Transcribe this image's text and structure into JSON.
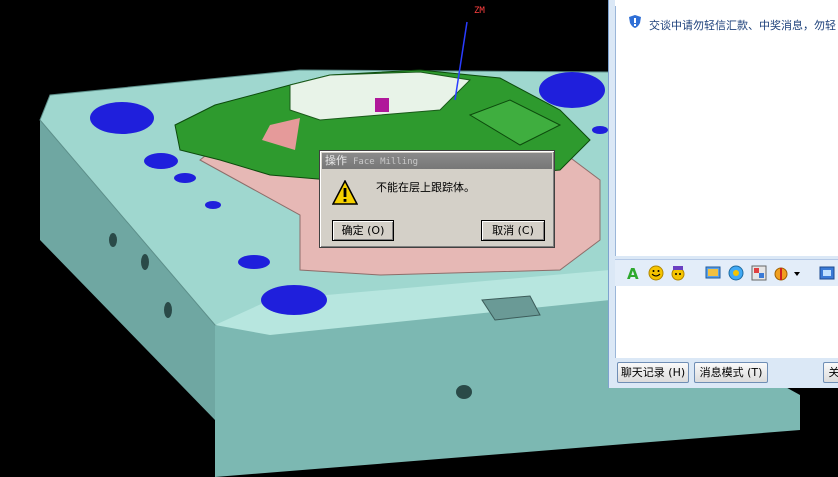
{
  "viewport": {
    "axis_label": "ZM"
  },
  "dialog": {
    "title": "操作",
    "app_name": "Face Milling",
    "message": "不能在层上跟踪体。",
    "ok_label": "确定 (O)",
    "cancel_label": "取消 (C)",
    "icon": "warning-icon"
  },
  "chat": {
    "notice": "交谈中请勿轻信汇款、中奖消息，勿轻",
    "toolbar_icons": [
      "font-icon",
      "emoticon-icon",
      "magic-emoticon-icon",
      "screenshot-icon",
      "music-icon",
      "image-icon",
      "gift-icon",
      "more-dropdown-icon",
      "capture-icon"
    ],
    "history_button": "聊天记录 (H)",
    "mode_button": "消息模式 (T)",
    "close_button": "关"
  },
  "colors": {
    "mold_base": "#9fd7cf",
    "part_green": "#2e9a2e",
    "pink_wall": "#e6b8b5",
    "hole_blue": "#1f1fdc",
    "dialog_bg": "#d4d0c8"
  }
}
